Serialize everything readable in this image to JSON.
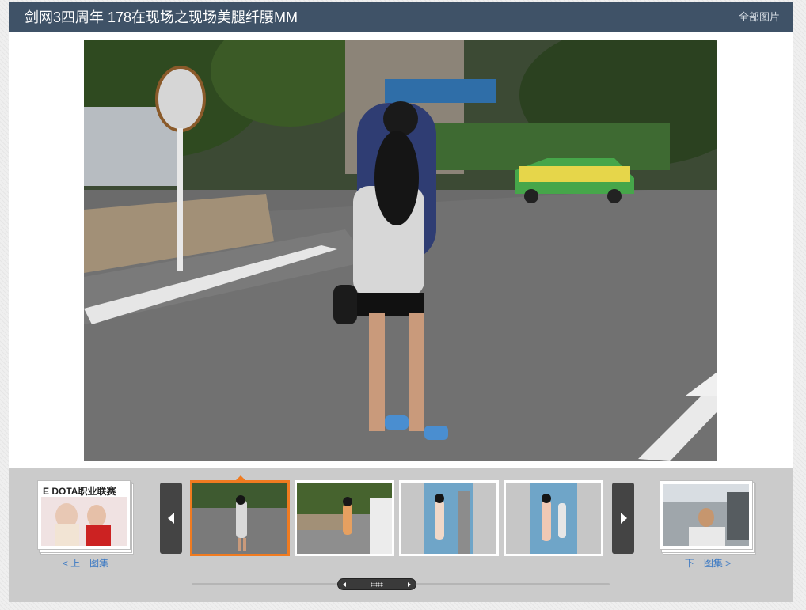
{
  "header": {
    "title": "剑网3四周年 178在现场之现场美腿纤腰MM",
    "all_link": "全部图片"
  },
  "strip": {
    "prev_album_label": "< 上一图集",
    "next_album_label": "下一图集 >",
    "prev_album_banner_text": "E DOTA职业联赛",
    "active_thumbnail_index": 0,
    "thumbnail_count": 4
  },
  "colors": {
    "header_bg": "#3f5267",
    "active_border": "#f07b20",
    "link": "#3a78c3",
    "strip_bg": "#cbcbcb"
  },
  "icons": {
    "prev": "chevron-left-icon",
    "next": "chevron-right-icon"
  }
}
